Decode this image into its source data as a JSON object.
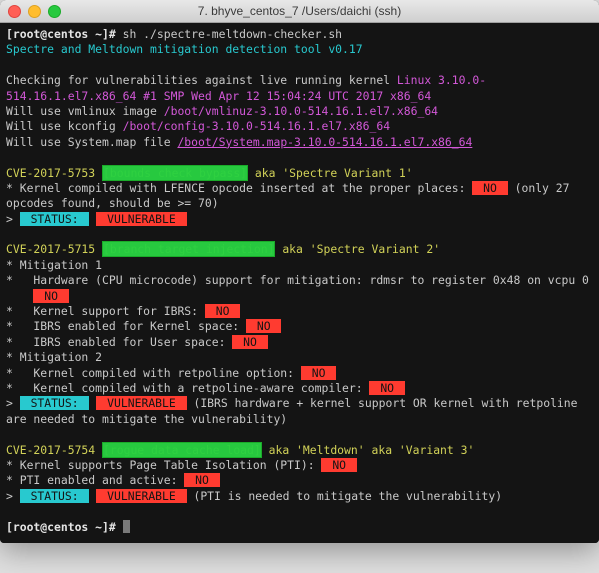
{
  "titlebar": {
    "title": "7. bhyve_centos_7    /Users/daichi (ssh)"
  },
  "prompt": {
    "part1": "[root@centos ~]#",
    "cmd": " sh ./spectre-meltdown-checker.sh"
  },
  "header": {
    "tool": "Spectre and Meltdown mitigation detection tool v0.17"
  },
  "check": {
    "line1_a": "Checking for vulnerabilities against live running kernel ",
    "line1_b": "Linux 3.10.0-514.16.1.el7.x86_64 #1 SMP Wed Apr 12 15:04:24 UTC 2017 x86_64",
    "line2_a": "Will use vmlinux image ",
    "line2_b": "/boot/vmlinuz-3.10.0-514.16.1.el7.x86_64",
    "line3_a": "Will use kconfig ",
    "line3_b": "/boot/config-3.10.0-514.16.1.el7.x86_64",
    "line4_a": "Will use System.map file ",
    "line4_b": "/boot/System.map-3.10.0-514.16.1.el7.x86_64"
  },
  "cve1": {
    "title_a": "CVE-2017-5753 ",
    "title_b": "[bounds check bypass]",
    "title_c": " aka 'Spectre Variant 1'",
    "l1": "* Kernel compiled with LFENCE opcode inserted at the proper places: ",
    "l1_no": " NO ",
    "l1_note": " (only 27 opcodes found, should be >= 70)",
    "status_pre": "> ",
    "status_lbl": " STATUS: ",
    "status_val": " VULNERABLE "
  },
  "cve2": {
    "title_a": "CVE-2017-5715 ",
    "title_b": "[branch target injection]",
    "title_c": " aka 'Spectre Variant 2'",
    "m1": "* Mitigation 1",
    "hw": "*   Hardware (CPU microcode) support for mitigation: rdmsr to register 0x48 on vcpu 0",
    "hw_no": " NO ",
    "kibrs": "*   Kernel support for IBRS: ",
    "kibrs_no": " NO ",
    "kspace": "*   IBRS enabled for Kernel space: ",
    "kspace_no": " NO ",
    "uspace": "*   IBRS enabled for User space: ",
    "uspace_no": " NO ",
    "m2": "* Mitigation 2",
    "retop": "*   Kernel compiled with retpoline option: ",
    "retop_no": " NO ",
    "retcomp": "*   Kernel compiled with a retpoline-aware compiler: ",
    "retcomp_no": " NO ",
    "status_pre": "> ",
    "status_lbl": " STATUS: ",
    "status_val": " VULNERABLE ",
    "status_note": " (IBRS hardware + kernel support OR kernel with retpoline are needed to mitigate the vulnerability)"
  },
  "cve3": {
    "title_a": "CVE-2017-5754 ",
    "title_b": "[rogue data cache load]",
    "title_c": " aka 'Meltdown' aka 'Variant 3'",
    "l1": "* Kernel supports Page Table Isolation (PTI): ",
    "l1_no": " NO ",
    "l2": "* PTI enabled and active: ",
    "l2_no": " NO ",
    "status_pre": "> ",
    "status_lbl": " STATUS: ",
    "status_val": " VULNERABLE ",
    "status_note": " (PTI is needed to mitigate the vulnerability)"
  },
  "prompt2": {
    "part1": "[root@centos ~]# "
  }
}
